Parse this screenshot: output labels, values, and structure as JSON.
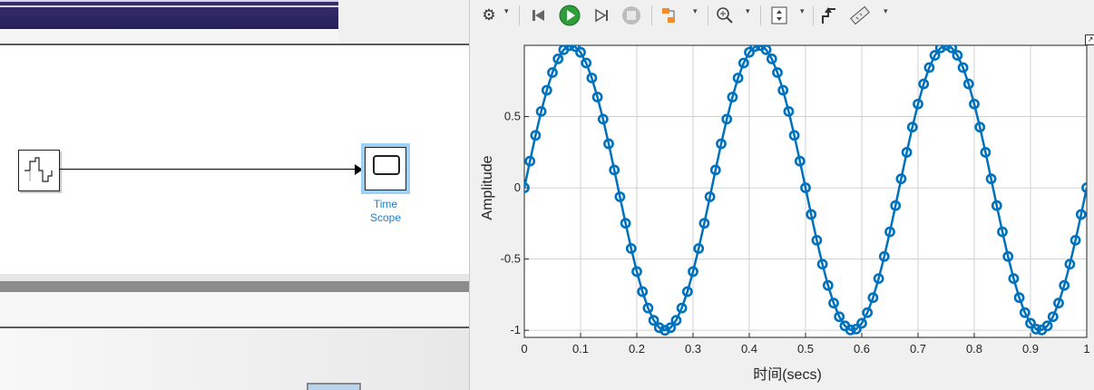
{
  "model": {
    "scope_block_label": [
      "Time",
      "Scope"
    ]
  },
  "toolbar": {
    "buttons": [
      {
        "name": "settings-icon",
        "glyph": "⚙"
      },
      {
        "name": "step-back-icon",
        "glyph": "⏮"
      },
      {
        "name": "run-icon",
        "glyph": "▶"
      },
      {
        "name": "step-forward-icon",
        "glyph": "⏭"
      },
      {
        "name": "stop-icon",
        "glyph": "■"
      },
      {
        "name": "highlight-block-icon",
        "glyph": "⊞"
      },
      {
        "name": "zoom-icon",
        "glyph": "⊕"
      },
      {
        "name": "scale-axes-icon",
        "glyph": "⤢"
      },
      {
        "name": "triggers-icon",
        "glyph": "⇪"
      },
      {
        "name": "measurements-icon",
        "glyph": "📐"
      }
    ]
  },
  "chart_data": {
    "type": "line",
    "title": "",
    "xlabel": "时间(secs)",
    "ylabel": "Amplitude",
    "xlim": [
      0,
      1
    ],
    "ylim": [
      -1.05,
      1.0
    ],
    "xticks": [
      0,
      0.1,
      0.2,
      0.3,
      0.4,
      0.5,
      0.6,
      0.7,
      0.8,
      0.9,
      1
    ],
    "xtick_labels": [
      "0",
      "0.1",
      "0.2",
      "0.3",
      "0.4",
      "0.5",
      "0.6",
      "0.7",
      "0.8",
      "0.9",
      "1"
    ],
    "yticks": [
      -1,
      -0.5,
      0,
      0.5
    ],
    "ytick_labels": [
      "-1",
      "-0.5",
      "0",
      "0.5"
    ],
    "grid": true,
    "marker": "circle",
    "color": "#0072bd",
    "series": [
      {
        "name": "",
        "x": [
          0,
          0.01,
          0.02,
          0.03,
          0.04,
          0.05,
          0.06,
          0.07,
          0.08,
          0.09,
          0.1,
          0.11,
          0.12,
          0.13,
          0.14,
          0.15,
          0.16,
          0.17,
          0.18,
          0.19,
          0.2,
          0.21,
          0.22,
          0.23,
          0.24,
          0.25,
          0.26,
          0.27,
          0.28,
          0.29,
          0.3,
          0.31,
          0.32,
          0.33,
          0.34,
          0.35,
          0.36,
          0.37,
          0.38,
          0.39,
          0.4,
          0.41,
          0.42,
          0.43,
          0.44,
          0.45,
          0.46,
          0.47,
          0.48,
          0.49,
          0.5,
          0.51,
          0.52,
          0.53,
          0.54,
          0.55,
          0.56,
          0.57,
          0.58,
          0.59,
          0.6,
          0.61,
          0.62,
          0.63,
          0.64,
          0.65,
          0.66,
          0.67,
          0.68,
          0.69,
          0.7,
          0.71,
          0.72,
          0.73,
          0.74,
          0.75,
          0.76,
          0.77,
          0.78,
          0.79,
          0.8,
          0.81,
          0.82,
          0.83,
          0.84,
          0.85,
          0.86,
          0.87,
          0.88,
          0.89,
          0.9,
          0.91,
          0.92,
          0.93,
          0.94,
          0.95,
          0.96,
          0.97,
          0.98,
          0.99,
          1
        ],
        "y": [
          0,
          0.187,
          0.368,
          0.536,
          0.685,
          0.809,
          0.905,
          0.969,
          0.998,
          0.992,
          0.951,
          0.876,
          0.771,
          0.637,
          0.482,
          0.309,
          0.125,
          -0.063,
          -0.249,
          -0.426,
          -0.588,
          -0.729,
          -0.844,
          -0.93,
          -0.982,
          -1.0,
          -0.982,
          -0.93,
          -0.844,
          -0.729,
          -0.588,
          -0.426,
          -0.249,
          -0.063,
          0.125,
          0.309,
          0.482,
          0.637,
          0.771,
          0.876,
          0.951,
          0.992,
          0.998,
          0.969,
          0.905,
          0.809,
          0.685,
          0.536,
          0.368,
          0.187,
          0,
          -0.187,
          -0.368,
          -0.536,
          -0.685,
          -0.809,
          -0.905,
          -0.969,
          -0.998,
          -0.992,
          -0.951,
          -0.876,
          -0.771,
          -0.637,
          -0.482,
          -0.309,
          -0.125,
          0.063,
          0.249,
          0.426,
          0.588,
          0.729,
          0.844,
          0.93,
          0.982,
          1.0,
          0.982,
          0.93,
          0.844,
          0.729,
          0.588,
          0.426,
          0.249,
          0.063,
          -0.125,
          -0.309,
          -0.482,
          -0.637,
          -0.771,
          -0.876,
          -0.951,
          -0.992,
          -0.998,
          -0.969,
          -0.905,
          -0.809,
          -0.685,
          -0.536,
          -0.368,
          -0.187,
          0
        ]
      }
    ]
  }
}
